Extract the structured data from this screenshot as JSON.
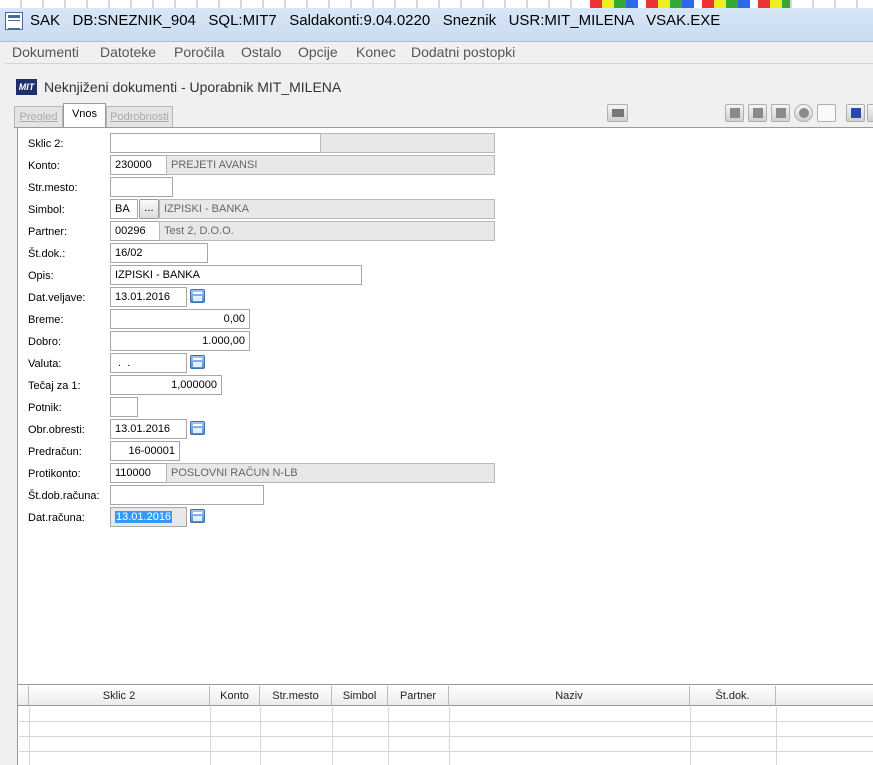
{
  "window": {
    "title": "SAK   DB:SNEZNIK_904   SQL:MIT7   Saldakonti:9.04.0220   Sneznik   USR:MIT_MILENA   VSAK.EXE"
  },
  "menu": [
    "Dokumenti",
    "Datoteke",
    "Poročila",
    "Ostalo",
    "Opcije",
    "Konec",
    "Dodatni postopki"
  ],
  "document": {
    "logo": "MIT",
    "title": "Neknjiženi dokumenti - Uporabnik MIT_MILENA"
  },
  "tabs": [
    "Pregled",
    "Vnos",
    "Podrobnosti"
  ],
  "form": {
    "sklic2": {
      "label": "Sklic 2:",
      "value": ""
    },
    "konto": {
      "label": "Konto:",
      "code": "230000",
      "name": "PREJETI AVANSI"
    },
    "strmesto": {
      "label": "Str.mesto:",
      "value": ""
    },
    "simbol": {
      "label": "Simbol:",
      "code": "BA",
      "button": "...",
      "name": "IZPISKI - BANKA"
    },
    "partner": {
      "label": "Partner:",
      "code": "00296",
      "name": "Test 2, D.O.O."
    },
    "stdok": {
      "label": "Št.dok.:",
      "value": "16/02"
    },
    "opis": {
      "label": "Opis:",
      "value": "IZPISKI - BANKA"
    },
    "datveljave": {
      "label": "Dat.veljave:",
      "value": "13.01.2016"
    },
    "breme": {
      "label": "Breme:",
      "value": "0,00"
    },
    "dobro": {
      "label": "Dobro:",
      "value": "1.000,00"
    },
    "valuta": {
      "label": "Valuta:",
      "value": " .  ."
    },
    "tecaj": {
      "label": "Tečaj za 1:",
      "value": "1,000000"
    },
    "potnik": {
      "label": "Potnik:",
      "value": ""
    },
    "obrobresti": {
      "label": "Obr.obresti:",
      "value": "13.01.2016"
    },
    "predracun": {
      "label": "Predračun:",
      "value": "16-00001"
    },
    "protikonto": {
      "label": "Protikonto:",
      "code": "110000",
      "name": "POSLOVNI RAČUN N-LB"
    },
    "stdobracuna": {
      "label": "Št.dob.računa:",
      "value": ""
    },
    "datracuna": {
      "label": "Dat.računa:",
      "value": "13.01.2016"
    }
  },
  "grid": {
    "columns": [
      "Sklic 2",
      "Konto",
      "Str.mesto",
      "Simbol",
      "Partner",
      "Naziv",
      "Št.dok."
    ]
  },
  "colors": {
    "selection": "#3399ff",
    "logo": "#1e2f6e"
  },
  "icons": [
    "app-icon",
    "calendar-icon",
    "window-icon",
    "copy-icon",
    "paste-icon",
    "record-icon",
    "save-icon"
  ]
}
